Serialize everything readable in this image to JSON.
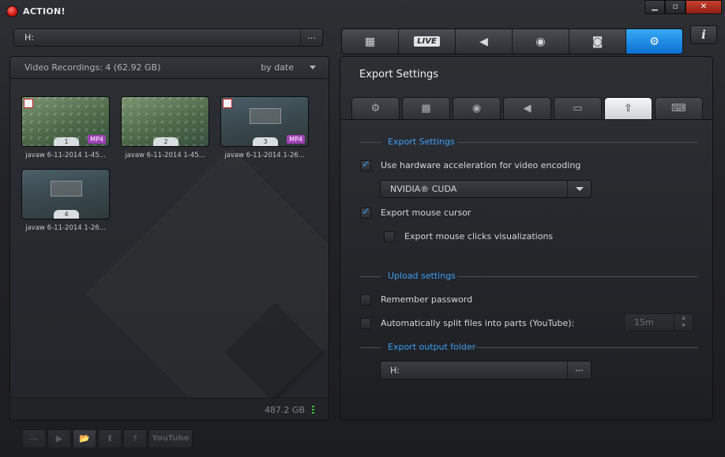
{
  "app": {
    "title": "ACTION!"
  },
  "window_controls": {
    "minimize": "▁",
    "maximize": "▫",
    "close": "✕"
  },
  "left": {
    "path": {
      "value": "H:",
      "browse_label": "..."
    },
    "recordings": {
      "title": "Video Recordings: 4 (62.92 GB)",
      "sort_label": "by date",
      "items": [
        {
          "number": "1",
          "format": "MP4",
          "caption": "javaw 6-11-2014 1-45...",
          "style": "grid"
        },
        {
          "number": "2",
          "format": "",
          "caption": "javaw 6-11-2014 1-45...",
          "style": "grid"
        },
        {
          "number": "3",
          "format": "MP4",
          "caption": "javaw 6-11-2014 1-26...",
          "style": "dark"
        },
        {
          "number": "4",
          "format": "",
          "caption": "javaw 6-11-2014 1-26...",
          "style": "dark"
        }
      ],
      "disk_space": "487.2 GB"
    },
    "toolbar": {
      "delete": "—",
      "play": "▶",
      "folder": "📂",
      "upload": "⬆",
      "facebook": "f",
      "youtube": "YouTube"
    }
  },
  "main_tabs": [
    {
      "name": "video-tab",
      "icon": "film-icon",
      "glyph": "▦"
    },
    {
      "name": "live-tab",
      "icon": "live-icon",
      "label": "LIVE"
    },
    {
      "name": "audio-tab",
      "icon": "speaker-icon",
      "glyph": "◀"
    },
    {
      "name": "benchmark-tab",
      "icon": "stopwatch-icon",
      "glyph": "◉"
    },
    {
      "name": "screenshot-tab",
      "icon": "camera-icon",
      "glyph": "◙"
    },
    {
      "name": "settings-tab",
      "icon": "gear-icon",
      "glyph": "⚙"
    }
  ],
  "info_label": "i",
  "settings": {
    "title": "Export Settings",
    "sub_tabs": [
      {
        "name": "general",
        "icon": "gear-icon",
        "glyph": "⚙"
      },
      {
        "name": "video",
        "icon": "film-icon",
        "glyph": "▦"
      },
      {
        "name": "webcam",
        "icon": "webcam-icon",
        "glyph": "◉"
      },
      {
        "name": "audio",
        "icon": "speaker-icon",
        "glyph": "◀"
      },
      {
        "name": "display",
        "icon": "monitor-icon",
        "glyph": "▭"
      },
      {
        "name": "export",
        "icon": "upload-icon",
        "glyph": "⇧"
      },
      {
        "name": "hotkeys",
        "icon": "keyboard-icon",
        "glyph": "⌨"
      }
    ],
    "export_section": "Export Settings",
    "hw_accel": {
      "label": "Use hardware acceleration for video encoding",
      "checked": true
    },
    "encoder": {
      "value": "NVIDIA® CUDA"
    },
    "mouse_cursor": {
      "label": "Export mouse cursor",
      "checked": true
    },
    "mouse_clicks": {
      "label": "Export mouse clicks visualizations",
      "checked": false
    },
    "upload_section": "Upload settings",
    "remember_password": {
      "label": "Remember password",
      "checked": false
    },
    "split_files": {
      "label": "Automatically split files into parts (YouTube):",
      "checked": false,
      "value": "15m"
    },
    "output_section": "Export output folder",
    "output_folder": {
      "value": "H:",
      "browse_label": "..."
    }
  },
  "colors": {
    "accent": "#1d8fe8",
    "section_label": "#3c9ef4",
    "record": "#d01810",
    "mp4_badge": "#a040b8"
  }
}
